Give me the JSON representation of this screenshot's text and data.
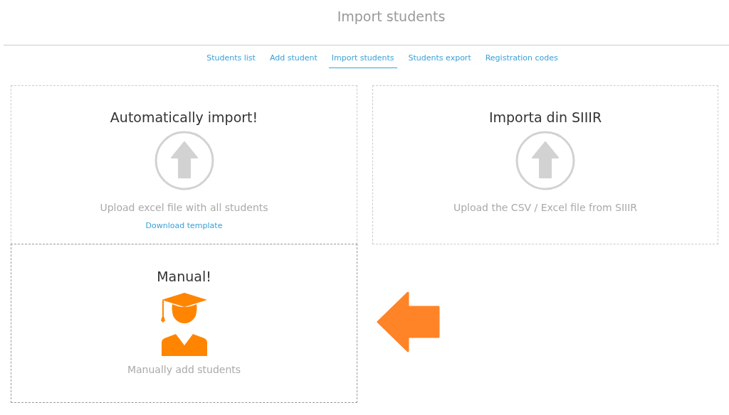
{
  "page": {
    "title": "Import students"
  },
  "tabs": [
    {
      "label": "Students list",
      "selected": false
    },
    {
      "label": "Add student",
      "selected": false
    },
    {
      "label": "Import students",
      "selected": true
    },
    {
      "label": "Students export",
      "selected": false
    },
    {
      "label": "Registration codes",
      "selected": false
    }
  ],
  "cards": [
    {
      "kind": "upload",
      "title": "Automatically import!",
      "caption": "Upload excel file with all students",
      "link": "Download template"
    },
    {
      "kind": "upload",
      "title": "Importa din SIIIR",
      "caption": "Upload the CSV / Excel file from SIIIR"
    },
    {
      "kind": "manual",
      "title": "Manual!",
      "caption": "Manually add students"
    }
  ]
}
